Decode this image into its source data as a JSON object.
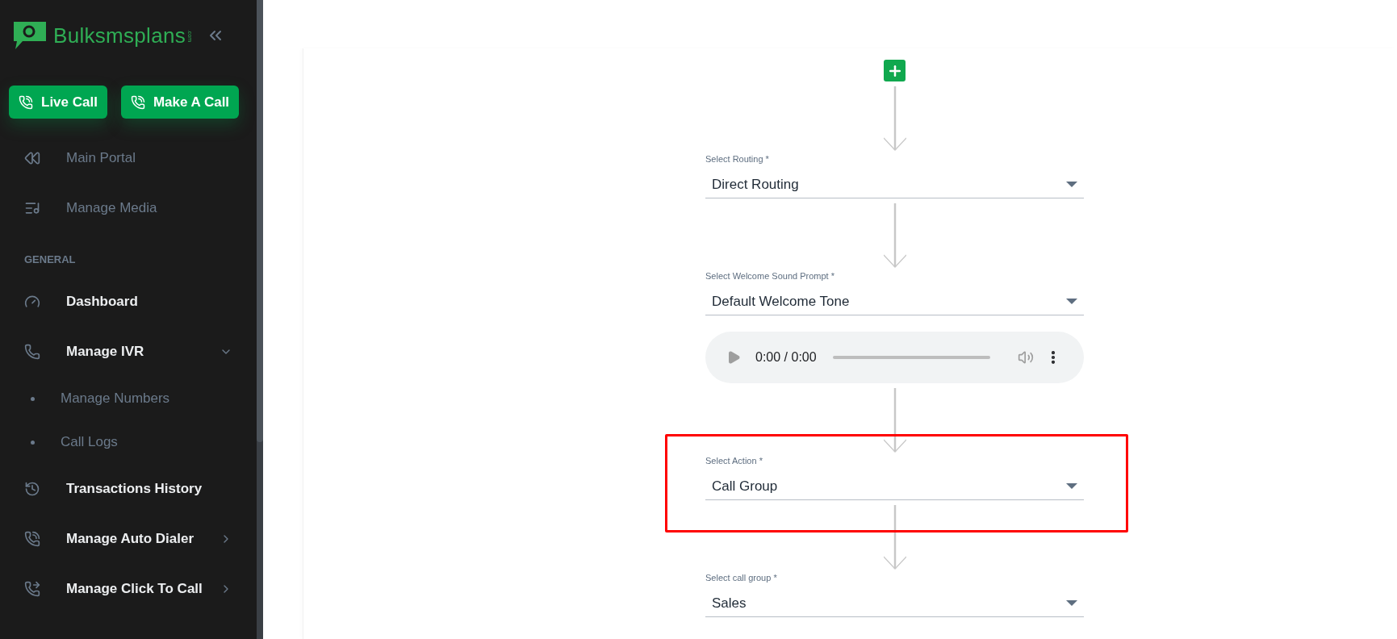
{
  "sidebar": {
    "logo": {
      "name": "Bulksmsplans",
      "suffix": ".com"
    },
    "buttons": [
      {
        "label": "Live Call"
      },
      {
        "label": "Make A Call"
      }
    ],
    "items": [
      {
        "kind": "link",
        "label": "Main Portal",
        "muted": true
      },
      {
        "kind": "link",
        "label": "Manage Media",
        "muted": true
      },
      {
        "kind": "heading",
        "label": "GENERAL"
      },
      {
        "kind": "link",
        "label": "Dashboard",
        "muted": false
      },
      {
        "kind": "group",
        "label": "Manage IVR",
        "expanded": true,
        "children": [
          {
            "label": "Manage Numbers"
          },
          {
            "label": "Call Logs"
          }
        ]
      },
      {
        "kind": "link",
        "label": "Transactions History",
        "muted": false
      },
      {
        "kind": "group",
        "label": "Manage Auto Dialer",
        "expanded": false
      },
      {
        "kind": "group",
        "label": "Manage Click To Call",
        "expanded": false
      }
    ]
  },
  "flow": [
    {
      "kind": "add"
    },
    {
      "kind": "select",
      "label": "Select Routing *",
      "value": "Direct Routing",
      "highlighted": false
    },
    {
      "kind": "select",
      "label": "Select Welcome Sound Prompt *",
      "value": "Default Welcome Tone",
      "highlighted": false
    },
    {
      "kind": "audio",
      "time": "0:00 / 0:00"
    },
    {
      "kind": "select",
      "label": "Select Action *",
      "value": "Call Group",
      "highlighted": true
    },
    {
      "kind": "select",
      "label": "Select call group *",
      "value": "Sales",
      "highlighted": false
    }
  ]
}
